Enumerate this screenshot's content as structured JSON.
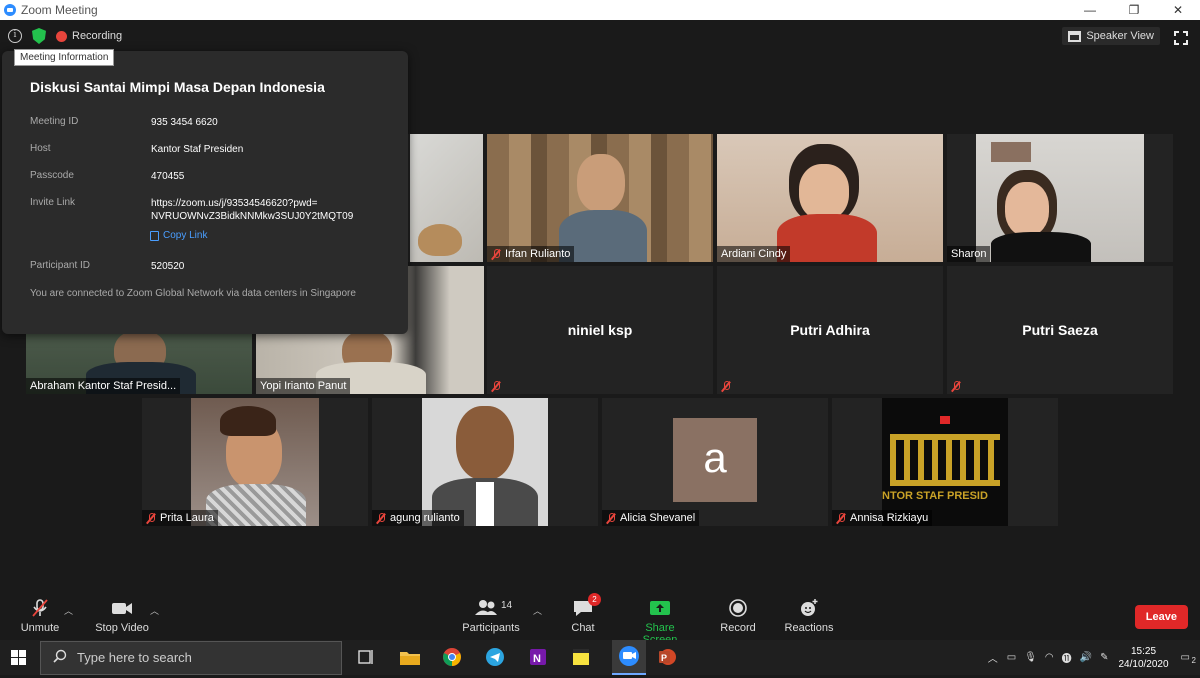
{
  "window": {
    "title": "Zoom Meeting",
    "minimize": "—",
    "restore": "❐",
    "close": "✕"
  },
  "topbar": {
    "recording_label": "Recording",
    "speaker_view_label": "Speaker View"
  },
  "meeting_info": {
    "tab_label": "Meeting Information",
    "title": "Diskusi Santai Mimpi Masa Depan Indonesia",
    "meeting_id_label": "Meeting ID",
    "meeting_id": "935 3454 6620",
    "host_label": "Host",
    "host": "Kantor Staf Presiden",
    "passcode_label": "Passcode",
    "passcode": "470455",
    "invite_label": "Invite Link",
    "invite_line1": "https://zoom.us/j/93534546620?pwd=",
    "invite_line2": "NVRUOWNvZ3BidkNNMkw3SUJ0Y2tMQT09",
    "copy_link": "Copy Link",
    "participant_id_label": "Participant ID",
    "participant_id": "520520",
    "connection_note": "You are connected to Zoom Global Network via data centers in Singapore"
  },
  "participants": [
    {
      "name": "Irfan Rulianto",
      "muted": true
    },
    {
      "name": "Ardiani Cindy",
      "muted": false
    },
    {
      "name": "Sharon",
      "muted": false
    },
    {
      "name": "Abraham Kantor Staf Presid...",
      "muted": false
    },
    {
      "name": "Yopi Irianto Panut",
      "muted": false
    },
    {
      "name": "niniel ksp",
      "muted": true
    },
    {
      "name": "Putri Adhira",
      "muted": true
    },
    {
      "name": "Putri Saeza",
      "muted": true
    },
    {
      "name": "Prita Laura",
      "muted": true
    },
    {
      "name": "agung rulianto",
      "muted": true
    },
    {
      "name": "Alicia Shevanel",
      "muted": true,
      "avatar_letter": "a"
    },
    {
      "name": "Annisa Rizkiayu",
      "muted": true,
      "banner_text": "NTOR STAF PRESID"
    }
  ],
  "controls": {
    "unmute": "Unmute",
    "stop_video": "Stop Video",
    "participants": "Participants",
    "participants_count": "14",
    "chat": "Chat",
    "chat_badge": "2",
    "share_screen": "Share Screen",
    "record": "Record",
    "reactions": "Reactions",
    "leave": "Leave"
  },
  "taskbar": {
    "search_placeholder": "Type here to search",
    "time": "15:25",
    "date": "24/10/2020",
    "notification_count": "2"
  },
  "colors": {
    "accent_green": "#23c24d",
    "leave_red": "#e02828",
    "link_blue": "#4a9eff",
    "speaker_outline": "#a3cf3f"
  }
}
